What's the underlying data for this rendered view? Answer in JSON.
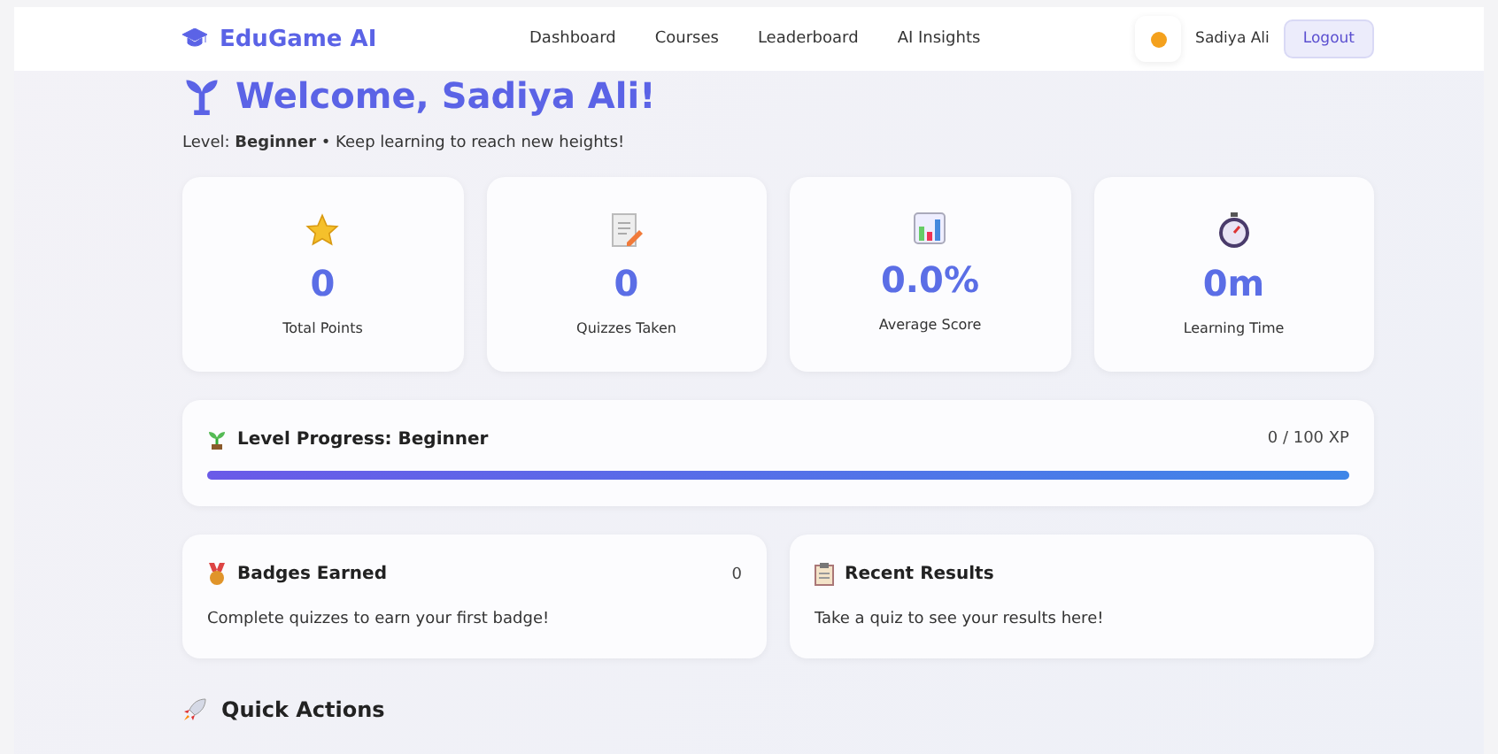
{
  "brand": "EduGame AI",
  "nav": [
    {
      "label": "Dashboard"
    },
    {
      "label": "Courses"
    },
    {
      "label": "Leaderboard"
    },
    {
      "label": "AI Insights"
    }
  ],
  "user": {
    "name": "Sadiya Ali",
    "logout": "Logout"
  },
  "welcome": {
    "title": "Welcome, Sadiya Ali!",
    "subtitle": "Level: **Beginner** • Keep learning to reach new heights!"
  },
  "stats": [
    {
      "kind": "star",
      "value": "0",
      "label": "Total Points"
    },
    {
      "kind": "memo",
      "value": "0",
      "label": "Quizzes Taken"
    },
    {
      "kind": "chart",
      "value": "0.0%",
      "label": "Average Score"
    },
    {
      "kind": "timer",
      "value": "0m",
      "label": "Learning Time"
    }
  ],
  "progress": {
    "title": "Level Progress: Beginner",
    "reading": "0 / 100 XP",
    "level": 1
  },
  "panels": [
    {
      "kind": "medal",
      "title": "Badges Earned",
      "count": "0",
      "text": "Complete quizzes to earn your first badge!"
    },
    {
      "kind": "clipboard",
      "title": "Recent Results",
      "text": "Take a quiz to see your results here!"
    }
  ],
  "quick_actions": {
    "title": "Quick Actions"
  }
}
